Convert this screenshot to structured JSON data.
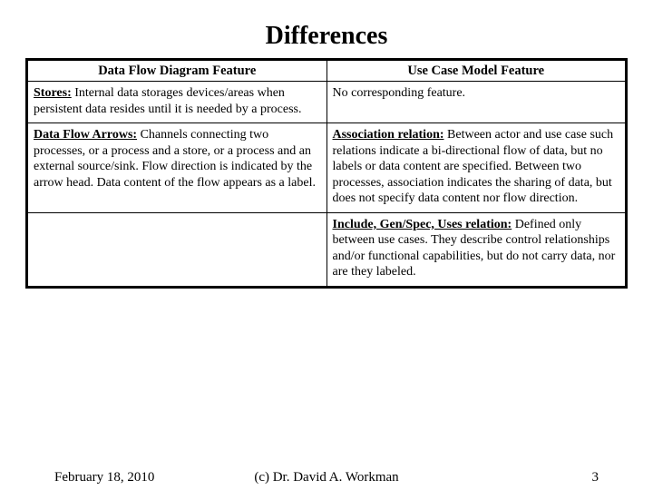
{
  "title": "Differences",
  "headers": {
    "left": "Data Flow Diagram Feature",
    "right": "Use Case Model Feature"
  },
  "rows": [
    {
      "left_term": "Stores:",
      "left_rest": " Internal data storages devices/areas when persistent data resides until it is needed by a process.",
      "right_term": "",
      "right_rest": "No corresponding feature."
    },
    {
      "left_term": "Data Flow Arrows:",
      "left_rest": "  Channels connecting two processes, or a process and a store, or a process and an external source/sink.  Flow direction is indicated by the arrow head.  Data content of the flow appears as a label.",
      "right_term": "Association relation:",
      "right_rest": "  Between actor and use case such relations indicate a bi-directional flow of data, but no labels or data content are specified.  Between two processes, association indicates the sharing of data, but does not specify data content nor flow direction."
    },
    {
      "left_term": "",
      "left_rest": "",
      "right_term": "Include, Gen/Spec, Uses relation:",
      "right_rest": "  Defined only between use cases.  They describe control relationships and/or functional capabilities, but do not carry data, nor are they labeled."
    }
  ],
  "footer": {
    "date": "February 18, 2010",
    "copyright": "(c) Dr. David A. Workman",
    "page": "3"
  }
}
